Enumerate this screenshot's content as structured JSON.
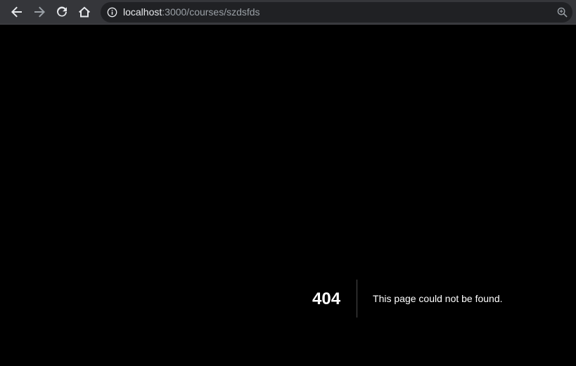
{
  "browser": {
    "url_host": "localhost",
    "url_rest": ":3000/courses/szdsfds",
    "icons": {
      "back": "arrow-left-icon",
      "forward": "arrow-right-icon",
      "reload": "reload-icon",
      "home": "home-icon",
      "site_info": "info-icon",
      "zoom": "zoom-in-icon"
    },
    "colors": {
      "toolbar": "#35363a",
      "omnibox": "#202124",
      "icon_active": "#e8eaed",
      "icon_disabled": "#9aa0a6"
    }
  },
  "page": {
    "error_code": "404",
    "error_message": "This page could not be found.",
    "background": "#000000",
    "text_color": "#ffffff"
  }
}
